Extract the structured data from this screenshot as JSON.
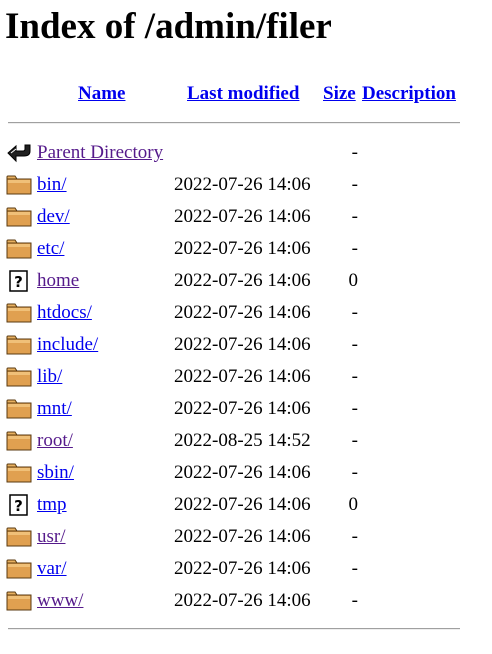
{
  "page": {
    "title": "Index of /admin/filer"
  },
  "header": {
    "name": "Name",
    "last_modified": "Last modified",
    "size": "Size",
    "description": "Description"
  },
  "colors": {
    "link": "#0000ee",
    "visited_link": "#551a8b",
    "folder_fill": "#e0a050",
    "folder_stroke": "#5a3a10"
  },
  "parent": {
    "icon": "back-arrow-icon",
    "name": "Parent Directory",
    "date": "",
    "size": "-",
    "description": ""
  },
  "entries": [
    {
      "icon": "folder-icon",
      "name": "bin/",
      "date": "2022-07-26 14:06",
      "size": "-",
      "description": "",
      "visited": false
    },
    {
      "icon": "folder-icon",
      "name": "dev/",
      "date": "2022-07-26 14:06",
      "size": "-",
      "description": "",
      "visited": false
    },
    {
      "icon": "folder-icon",
      "name": "etc/",
      "date": "2022-07-26 14:06",
      "size": "-",
      "description": "",
      "visited": false
    },
    {
      "icon": "unknown-file-icon",
      "name": "home",
      "date": "2022-07-26 14:06",
      "size": "0",
      "description": "",
      "visited": true
    },
    {
      "icon": "folder-icon",
      "name": "htdocs/",
      "date": "2022-07-26 14:06",
      "size": "-",
      "description": "",
      "visited": false
    },
    {
      "icon": "folder-icon",
      "name": "include/",
      "date": "2022-07-26 14:06",
      "size": "-",
      "description": "",
      "visited": false
    },
    {
      "icon": "folder-icon",
      "name": "lib/",
      "date": "2022-07-26 14:06",
      "size": "-",
      "description": "",
      "visited": false
    },
    {
      "icon": "folder-icon",
      "name": "mnt/",
      "date": "2022-07-26 14:06",
      "size": "-",
      "description": "",
      "visited": false
    },
    {
      "icon": "folder-icon",
      "name": "root/",
      "date": "2022-08-25 14:52",
      "size": "-",
      "description": "",
      "visited": true
    },
    {
      "icon": "folder-icon",
      "name": "sbin/",
      "date": "2022-07-26 14:06",
      "size": "-",
      "description": "",
      "visited": false
    },
    {
      "icon": "unknown-file-icon",
      "name": "tmp",
      "date": "2022-07-26 14:06",
      "size": "0",
      "description": "",
      "visited": false
    },
    {
      "icon": "folder-icon",
      "name": "usr/",
      "date": "2022-07-26 14:06",
      "size": "-",
      "description": "",
      "visited": true
    },
    {
      "icon": "folder-icon",
      "name": "var/",
      "date": "2022-07-26 14:06",
      "size": "-",
      "description": "",
      "visited": false
    },
    {
      "icon": "folder-icon",
      "name": "www/",
      "date": "2022-07-26 14:06",
      "size": "-",
      "description": "",
      "visited": true
    }
  ]
}
